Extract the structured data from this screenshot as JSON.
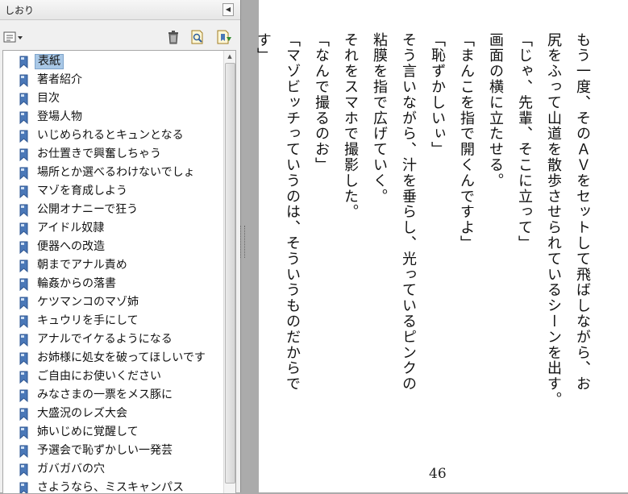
{
  "bookmarks_panel": {
    "title": "しおり",
    "items": [
      {
        "label": "表紙"
      },
      {
        "label": "著者紹介"
      },
      {
        "label": "目次"
      },
      {
        "label": "登場人物"
      },
      {
        "label": "いじめられるとキュンとなる"
      },
      {
        "label": "お仕置きで興奮しちゃう"
      },
      {
        "label": "場所とか選べるわけないでしょ"
      },
      {
        "label": "マゾを育成しよう"
      },
      {
        "label": "公開オナニーで狂う"
      },
      {
        "label": "アイドル奴隷"
      },
      {
        "label": "便器への改造"
      },
      {
        "label": "朝までアナル責め"
      },
      {
        "label": "輪姦からの落書"
      },
      {
        "label": "ケツマンコのマゾ姉"
      },
      {
        "label": "キュウリを手にして"
      },
      {
        "label": "アナルでイケるようになる"
      },
      {
        "label": "お姉様に処女を破ってほしいです"
      },
      {
        "label": "ご自由にお使いください"
      },
      {
        "label": "みなさまの一票をメス豚に"
      },
      {
        "label": "大盛況のレズ大会"
      },
      {
        "label": "姉いじめに覚醒して"
      },
      {
        "label": "予選会で恥ずかしい一発芸"
      },
      {
        "label": "ガバガバの穴"
      },
      {
        "label": "さようなら、ミスキャンパス"
      }
    ],
    "selected_index": 0
  },
  "page": {
    "lines": [
      "もう一度、そのＡＶをセットして飛ばしながら、お",
      "尻をふって山道を散歩させられているシーンを出す。",
      "「じゃ、先輩、そこに立って」",
      "画面の横に立たせる。",
      "「まんこを指で開くんですよ」",
      "「恥ずかしいぃ」",
      "そう言いながら、汁を垂らし、光っているピンクの",
      "粘膜を指で広げていく。",
      "それをスマホで撮影した。",
      "「なんで撮るのお」",
      "「マゾビッチっていうのは、そういうものだからで",
      "す」"
    ],
    "page_number": "46"
  },
  "colors": {
    "panel_bg": "#f0f0f0",
    "selection": "#a9c8e6",
    "viewer_bg": "#ababab",
    "bookmark_icon": "#4a78b8"
  }
}
